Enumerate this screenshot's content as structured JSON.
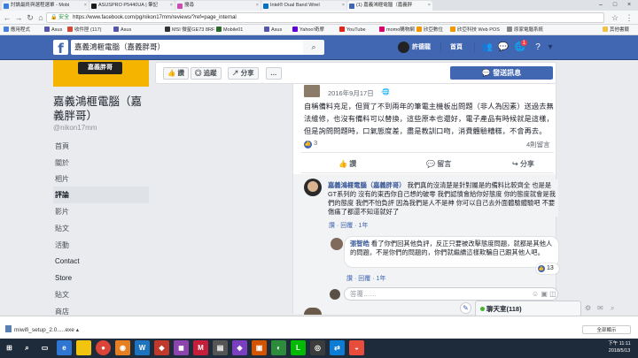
{
  "browser": {
    "tabs": [
      {
        "label": "討論最終與選程選單 - Mobi",
        "color": "#3b7ddd"
      },
      {
        "label": "ASUSPRO P5440UA | 筆記",
        "color": "#1a1a1a"
      },
      {
        "label": "搜尋",
        "color": "#c94cb1"
      },
      {
        "label": "Intel® Dual Band Wirel",
        "color": "#0071c5"
      },
      {
        "label": "(1) 嘉義鴻榧電腦（嘉義胖",
        "color": "#4267b2"
      }
    ],
    "security_label": "安全",
    "url": "https://www.facebook.com/pg/nikon17mm/reviews/?ref=page_internal",
    "bookmarks": [
      {
        "label": "應用程式",
        "color": "#4a7fd8"
      },
      {
        "label": "Asus",
        "color": "#5555aa"
      },
      {
        "label": "收件匣 (117)",
        "color": "#d14836"
      },
      {
        "label": "Asus",
        "color": "#5555aa"
      },
      {
        "label": "MSI 微星GE73 8RF",
        "color": "#333"
      },
      {
        "label": "Mobile01",
        "color": "#2d6a2d"
      },
      {
        "label": "Asus",
        "color": "#5555aa"
      },
      {
        "label": "Yahoo!奇摩",
        "color": "#6001d2"
      },
      {
        "label": "YouTube",
        "color": "#e62117"
      },
      {
        "label": "momo購物網",
        "color": "#d6006c"
      },
      {
        "label": "欣亞數位",
        "color": "#f39800"
      },
      {
        "label": "欣亞科技 Web POS",
        "color": "#f39800"
      },
      {
        "label": "原家電腦系統",
        "color": "#888"
      },
      {
        "label": "其他書籤",
        "color": "#f0c14b"
      }
    ]
  },
  "fb": {
    "search_value": "嘉義鴻榧電腦（嘉義胖哥）",
    "user_name": "許德龍",
    "home_label": "首頁",
    "notif_count": "1"
  },
  "page": {
    "cover_text": "嘉義胖哥",
    "name": "嘉義鴻榧電腦（嘉義胖哥）",
    "handle": "@nikon17mm",
    "nav": [
      "首頁",
      "關於",
      "相片",
      "評論",
      "影片",
      "貼文",
      "活動",
      "Contact",
      "Store",
      "貼文",
      "商店"
    ],
    "nav_active_index": 3
  },
  "actions": {
    "like": "讚",
    "follow": "追蹤",
    "share": "分享",
    "more": "…",
    "send_message": "發送訊息"
  },
  "review": {
    "date": "2016年9月17日",
    "text": "自稱備料充足，但買了不到兩年的筆電主機板出問題（非人為因素）送過去無法維修，也沒有備料可以替換，這些原本也還好，電子產品有時候就是這樣，但是詢問問題時，口氣態度差，盡是教訓口吻，消費體驗糟糕，不會再去。",
    "likes": "3",
    "comment_count": "4則留言",
    "like_label": "讚",
    "comment_label": "留言",
    "share_label": "分享"
  },
  "comments": [
    {
      "author": "嘉義鴻榧電腦（嘉義胖哥）",
      "text": "我們真的沒清楚是針對屬是的備料比較齊全 也是是GT系列的 沒有的東西你自己想的破零 我們認憤會給你好態度 你的態度就會是我們的態度 我們不怕負評 因為我們是人不是神 你可以自己去外面體驗體驗吧 不要傷痛了都還不知道就好了",
      "actions": "讚 · 回覆 · 1年"
    },
    {
      "author": "張智皓",
      "text": "看了你們回其他負評，反正只要被改擊態度問題，就都是其他人的問題，不是你們的問題的，你們就繼續這樣欺騙自己跟其他人吧。",
      "reactions": "13",
      "actions": "讚 · 回覆 · 1年"
    }
  ],
  "reply_placeholder": "答覆……",
  "chat": {
    "label": "聊天室(118)"
  },
  "download": {
    "file": "miwifi_setup_2.0.....exe",
    "show_all": "全部顯示"
  },
  "clock": {
    "time": "下午 11:11",
    "date": "2018/5/13"
  }
}
